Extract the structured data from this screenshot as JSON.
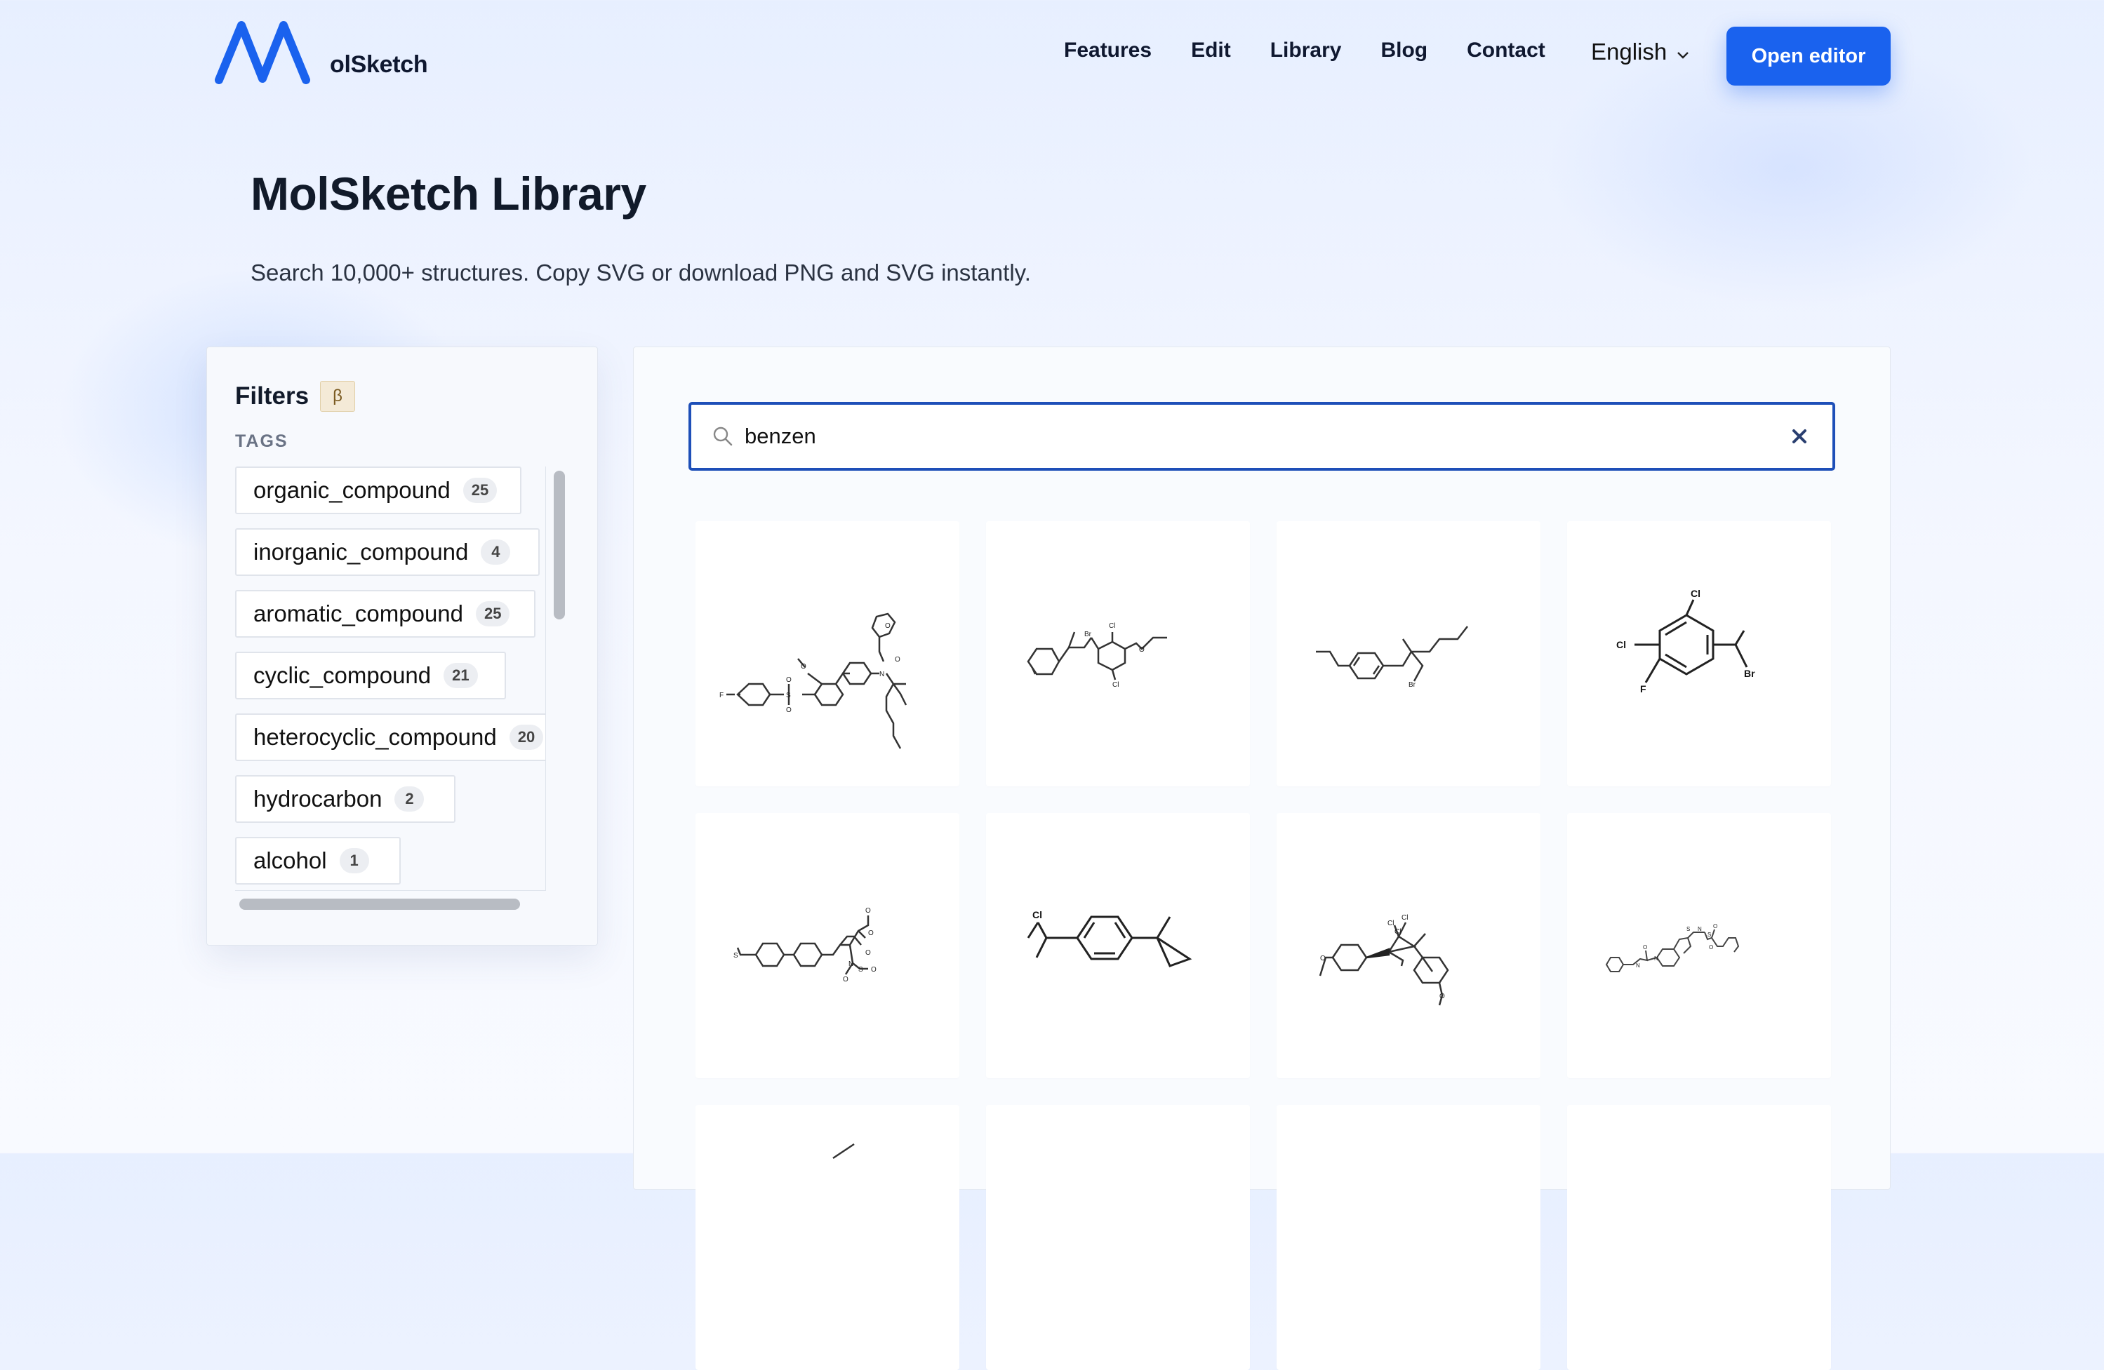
{
  "brand": {
    "name": "olSketch",
    "logo_letter": "M"
  },
  "nav": {
    "items": [
      {
        "label": "Features"
      },
      {
        "label": "Edit"
      },
      {
        "label": "Library"
      },
      {
        "label": "Blog"
      },
      {
        "label": "Contact"
      }
    ],
    "language": "English",
    "cta_label": "Open editor"
  },
  "page": {
    "title": "MolSketch Library",
    "subtitle": "Search 10,000+ structures. Copy SVG or download PNG and SVG instantly."
  },
  "filters": {
    "title": "Filters",
    "badge": "β",
    "tags_label": "TAGS",
    "tags": [
      {
        "name": "organic_compound",
        "count": "25"
      },
      {
        "name": "inorganic_compound",
        "count": "4"
      },
      {
        "name": "aromatic_compound",
        "count": "25"
      },
      {
        "name": "cyclic_compound",
        "count": "21"
      },
      {
        "name": "heterocyclic_compound",
        "count": "20"
      },
      {
        "name": "hydrocarbon",
        "count": "2"
      },
      {
        "name": "alcohol",
        "count": "1"
      }
    ]
  },
  "search": {
    "value": "benzen",
    "icon": "search-icon",
    "clear_icon": "close-icon"
  },
  "colors": {
    "accent": "#1a62ee",
    "search_border": "#1e4fb8"
  },
  "molecules": [
    {
      "atoms": [
        "F",
        "O",
        "S",
        "O",
        "O",
        "N",
        "O",
        "O"
      ]
    },
    {
      "atoms": [
        "Br",
        "Cl",
        "Cl",
        "O"
      ]
    },
    {
      "atoms": [
        "Br"
      ]
    },
    {
      "atoms": [
        "Cl",
        "Cl",
        "F",
        "Br"
      ]
    },
    {
      "atoms": [
        "S",
        "O",
        "N",
        "S",
        "O",
        "O",
        "O",
        "O"
      ]
    },
    {
      "atoms": [
        "Cl"
      ]
    },
    {
      "atoms": [
        "Cl",
        "Cl",
        "Cl",
        "O",
        "O"
      ]
    },
    {
      "atoms": [
        "N",
        "O",
        "N",
        "S",
        "N",
        "S",
        "O",
        "O"
      ]
    }
  ]
}
